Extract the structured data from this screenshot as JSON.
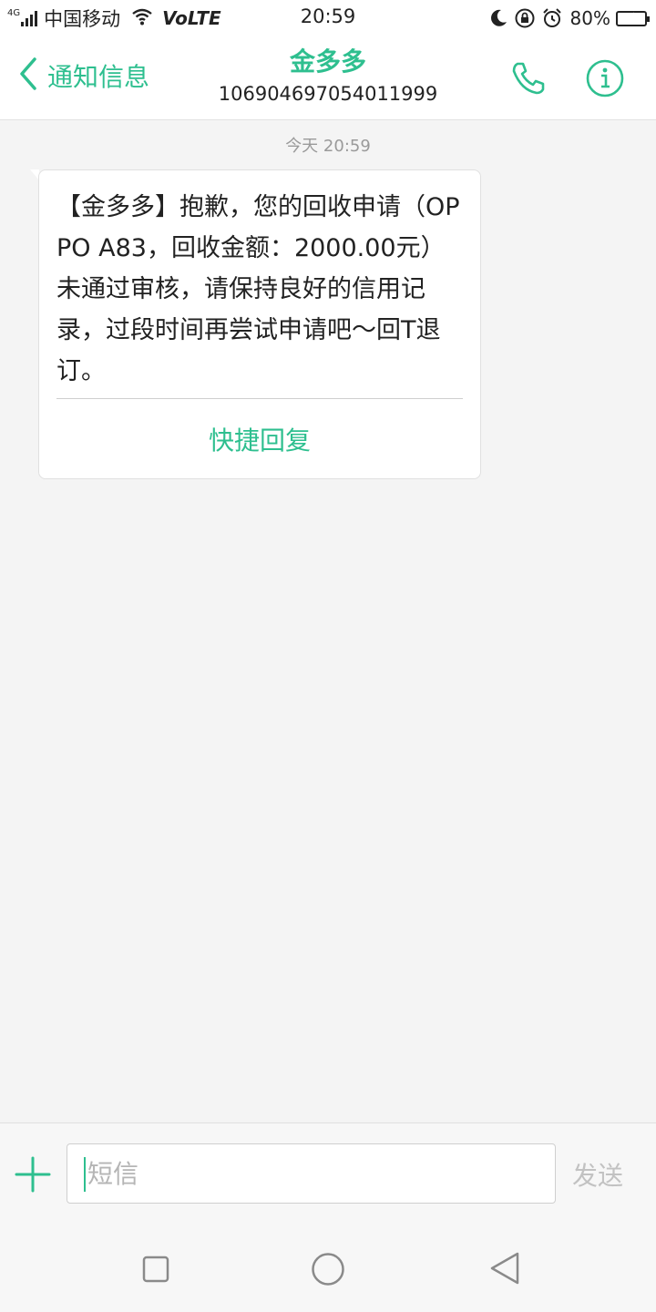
{
  "status_bar": {
    "network_type": "4G",
    "carrier": "中国移动",
    "volte": "VoLTE",
    "time": "20:59",
    "battery_percent": "80%",
    "battery_level": 0.8,
    "icons": [
      "signal-icon",
      "wifi-icon",
      "moon-icon",
      "rotation-lock-icon",
      "alarm-icon",
      "battery-icon"
    ]
  },
  "header": {
    "back_label": "通知信息",
    "title": "金多多",
    "subtitle": "106904697054011999",
    "icons": [
      "chevron-left-icon",
      "phone-icon",
      "info-icon"
    ]
  },
  "conversation": {
    "timestamp": "今天 20:59",
    "message": "【金多多】抱歉，您的回收申请（OPPO A83，回收金额：2000.00元）未通过审核，请保持良好的信用记录，过段时间再尝试申请吧～回T退订。",
    "quick_reply_label": "快捷回复"
  },
  "composer": {
    "placeholder": "短信",
    "send_label": "发送",
    "icons": [
      "plus-icon"
    ]
  },
  "nav_bar": {
    "icons": [
      "recent-apps-icon",
      "home-icon",
      "back-icon"
    ]
  },
  "colors": {
    "accent": "#2ebf8f",
    "background": "#f4f4f4",
    "bubble": "#ffffff",
    "placeholder": "#b5b5b5"
  }
}
